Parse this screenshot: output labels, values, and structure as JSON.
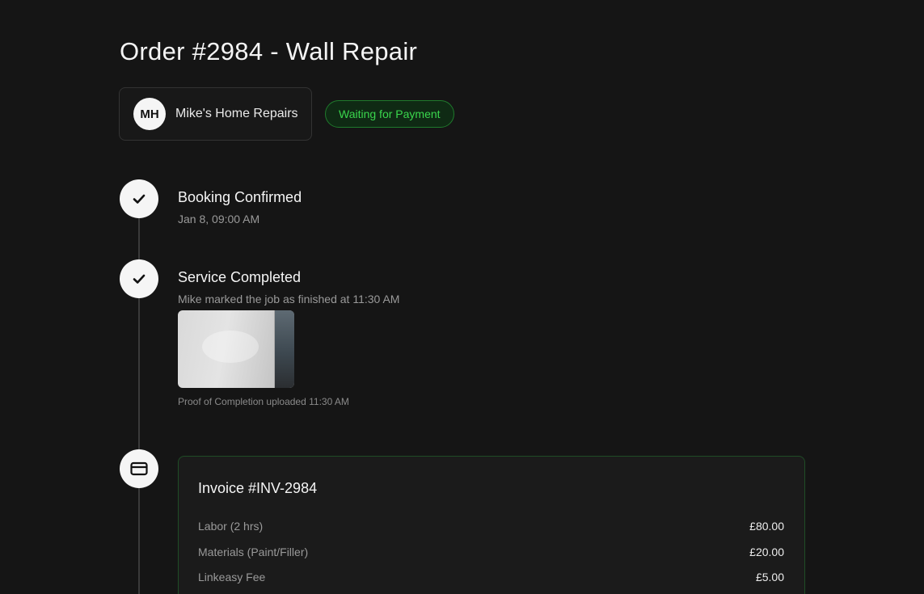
{
  "order": {
    "title": "Order #2984 - Wall Repair",
    "status": "Waiting for Payment"
  },
  "provider": {
    "initials": "MH",
    "name": "Mike's Home Repairs"
  },
  "timeline": {
    "steps": [
      {
        "icon": "check-icon",
        "title": "Booking Confirmed",
        "subtitle": "Jan 8, 09:00 AM"
      },
      {
        "icon": "check-icon",
        "title": "Service Completed",
        "subtitle": "Mike marked the job as finished at 11:30 AM",
        "proof_caption": "Proof of Completion uploaded 11:30 AM"
      },
      {
        "icon": "credit-card-icon"
      }
    ]
  },
  "invoice": {
    "title": "Invoice #INV-2984",
    "items": [
      {
        "label": "Labor (2 hrs)",
        "amount": "£80.00"
      },
      {
        "label": "Materials (Paint/Filler)",
        "amount": "£20.00"
      },
      {
        "label": "Linkeasy Fee",
        "amount": "£5.00"
      }
    ]
  },
  "colors": {
    "background": "#151515",
    "status_green": "#3ad64d",
    "invoice_border": "#1f4d26"
  }
}
